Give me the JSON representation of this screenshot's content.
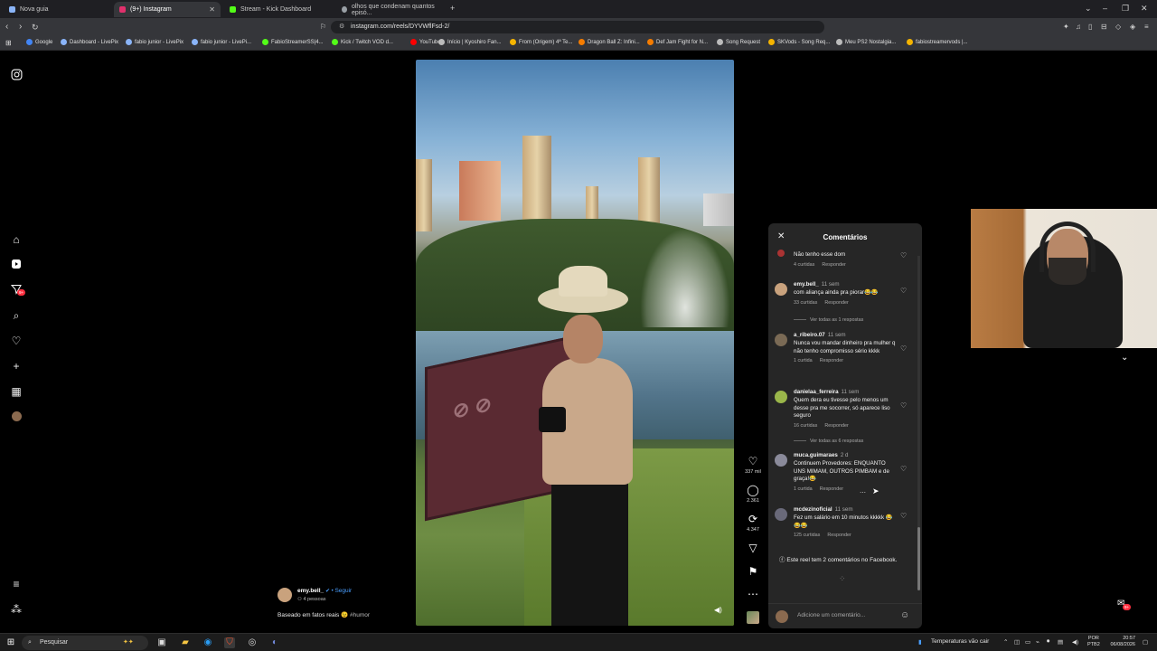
{
  "browser": {
    "tabs": [
      {
        "title": "Nova guia",
        "color": "#8ab4f8"
      },
      {
        "title": "(9+) Instagram",
        "color": "#e1306c"
      },
      {
        "title": "Stream - Kick Dashboard",
        "color": "#53fc18"
      },
      {
        "title": "olhos que condenam quantos episó...",
        "color": "#9aa0a6"
      }
    ],
    "new_tab": "+",
    "url": "instagram.com/reels/DYVWflFsd-2/",
    "bookmarks": [
      {
        "label": "Google",
        "color": "#4285f4"
      },
      {
        "label": "Dashboard - LivePix",
        "color": "#8ab4f8"
      },
      {
        "label": "fabio junior - LivePix",
        "color": "#8ab4f8"
      },
      {
        "label": "fabio junior - LivePi...",
        "color": "#8ab4f8"
      },
      {
        "label": "FabioStreamerSS|4...",
        "color": "#53fc18"
      },
      {
        "label": "Kick / Twitch VOD d...",
        "color": "#53fc18"
      },
      {
        "label": "YouTube",
        "color": "#ff0000"
      },
      {
        "label": "Início | Kyoshiro Fan...",
        "color": "#bbbbbb"
      },
      {
        "label": "From (Origem) 4ª Te...",
        "color": "#f5b400"
      },
      {
        "label": "Dragon Ball Z: Infini...",
        "color": "#f57c00"
      },
      {
        "label": "Def Jam Fight for N...",
        "color": "#f57c00"
      },
      {
        "label": "Song Request",
        "color": "#bbbbbb"
      },
      {
        "label": "SKVods - Song Req...",
        "color": "#f5b400"
      },
      {
        "label": "Meu PS2 Nostalgia...",
        "color": "#bbbbbb"
      },
      {
        "label": "fabiostreamervods |...",
        "color": "#f5b400"
      }
    ]
  },
  "sidebar": {
    "notification_badge": "9+"
  },
  "reel": {
    "likes": "337 mil",
    "comments": "2.361",
    "reposts": "4.347",
    "author": "emy.bell_",
    "follow": "Seguir",
    "audience": "4 pessoas",
    "caption": "Baseado em fatos reais",
    "caption_emoji": "😉",
    "hashtag": "#humor"
  },
  "comments_panel": {
    "title": "Comentários",
    "items": [
      {
        "user": "",
        "time": "",
        "text": "Não tenho esse dom",
        "likes": "4 curtidas",
        "reply": "Responder",
        "avatar_color": "#a33"
      },
      {
        "user": "emy.bell_",
        "time": "11 sem",
        "text": "com aliança ainda pra piorar😂😂",
        "likes": "33 curtidas",
        "reply": "Responder",
        "avatar_color": "#c9a27d",
        "view_more": "Ver todas as 1 respostas"
      },
      {
        "user": "a_ribeiro.07",
        "time": "11 sem",
        "text": "Nunca vou mandar dinheiro pra mulher q não tenho compromisso sério kkkk",
        "likes": "1 curtida",
        "reply": "Responder",
        "avatar_color": "#7a6a55"
      },
      {
        "user": "danielaa_ferreira",
        "time": "11 sem",
        "text": "Quem dera eu tivesse pelo menos um desse pra me socorrer, só aparece liso seguro",
        "likes": "16 curtidas",
        "reply": "Responder",
        "avatar_color": "#9ab64a",
        "view_more": "Ver todas as 6 respostas"
      },
      {
        "user": "muca.guimaraes",
        "time": "2 d",
        "text": "Continuem Provedores: ENQUANTO UNS MIMAM, OUTROS PIMBAM e de graça!😂",
        "likes": "1 curtida",
        "reply": "Responder",
        "avatar_color": "#8a8a9a"
      },
      {
        "user": "mcdezinoficial",
        "time": "11 sem",
        "text": "Fez um salário em 10 minutos kkkkk 😂😂😂",
        "likes": "125 curtidas",
        "reply": "Responder",
        "avatar_color": "#6a6a7a"
      }
    ],
    "facebook_note": "Este reel tem 2 comentários no Facebook.",
    "input_placeholder": "Adicione um comentário..."
  },
  "taskbar": {
    "search_placeholder": "Pesquisar",
    "weather": "Temperaturas vão cair",
    "lang": "POR",
    "lang2": "PTB2",
    "time": "20:57",
    "date": "06/08/2026"
  }
}
